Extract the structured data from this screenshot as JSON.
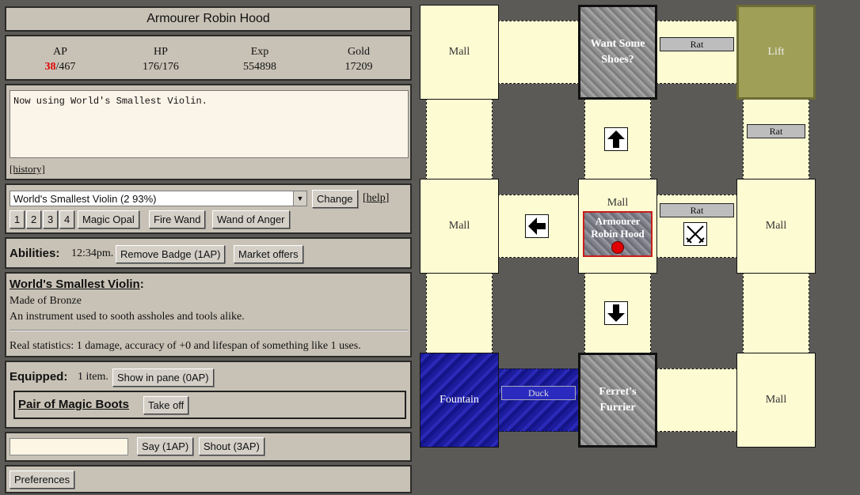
{
  "title": "Armourer Robin Hood",
  "stats": {
    "ap_label": "AP",
    "ap_current": "38",
    "ap_max": "/467",
    "hp_label": "HP",
    "hp_value": "176/176",
    "exp_label": "Exp",
    "exp_value": "554898",
    "gold_label": "Gold",
    "gold_value": "17209"
  },
  "log": {
    "message": "Now using World's Smallest Violin.",
    "history_link": "[history]"
  },
  "weapon": {
    "selected": "World's Smallest Violin (2 93%)",
    "change_label": "Change",
    "help_link": "help",
    "quick_slots": [
      "1",
      "2",
      "3",
      "4",
      "Magic Opal",
      "Fire Wand",
      "Wand of Anger"
    ]
  },
  "abilities": {
    "label": "Abilities:",
    "time": "12:34pm.",
    "buttons": [
      "Remove Badge (1AP)",
      "Market offers"
    ]
  },
  "item": {
    "name": "World's Smallest Violin",
    "material": "Made of Bronze",
    "description": "An instrument used to sooth assholes and tools alike.",
    "stats": "Real statistics: 1 damage, accuracy of +0 and lifespan of something like 1 uses."
  },
  "equipped": {
    "label": "Equipped:",
    "count": "1 item.",
    "show_button": "Show in pane (0AP)",
    "item_name": "Pair of Magic Boots",
    "take_off_button": "Take off"
  },
  "speech": {
    "input_value": "",
    "say_button": "Say (1AP)",
    "shout_button": "Shout (3AP)"
  },
  "preferences_button": "Preferences",
  "map": {
    "tiles": {
      "mall_tl": "Mall",
      "shop_top": "Want Some Shoes?",
      "lift": "Lift",
      "mall_ml": "Mall",
      "center_label": "Mall",
      "player_name": "Armourer Robin Hood",
      "mall_mr": "Mall",
      "fountain": "Fountain",
      "shop_bottom": "Ferret's Furrier",
      "mall_br": "Mall"
    },
    "npcs": {
      "rat_top": "Rat",
      "rat_right": "Rat",
      "rat_center": "Rat",
      "duck": "Duck"
    },
    "colors": {
      "floor": "#fdfbd2",
      "lift": "#9f9f58",
      "water": "#1c1c9c",
      "player_marker": "#e00000"
    }
  }
}
